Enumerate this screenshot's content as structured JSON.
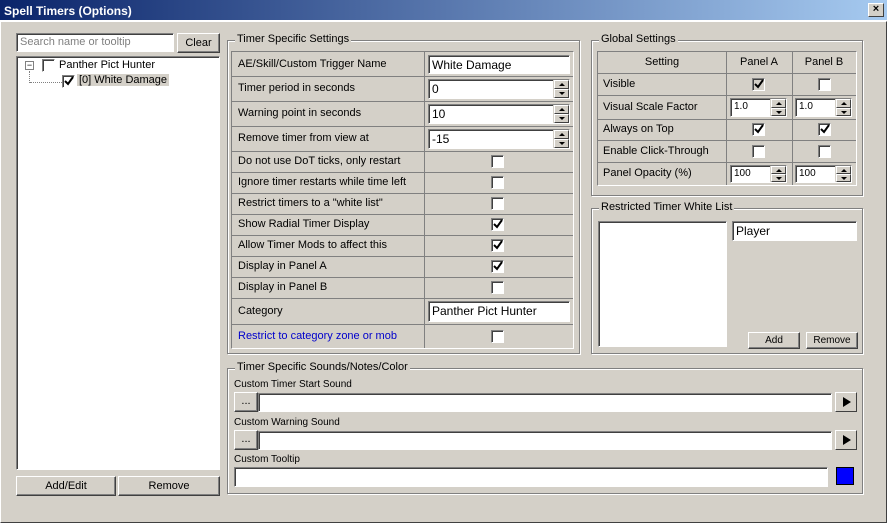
{
  "window": {
    "title": "Spell Timers (Options)",
    "close_glyph": "×"
  },
  "left": {
    "search_placeholder": "Search name or tooltip",
    "clear_label": "Clear",
    "tree": {
      "root_expander": "−",
      "root_label": "Panther Pict Hunter",
      "child_label": "[0] White Damage"
    },
    "add_edit_label": "Add/Edit",
    "remove_label": "Remove"
  },
  "timer_settings": {
    "title": "Timer Specific Settings",
    "rows": [
      {
        "label": "AE/Skill/Custom Trigger Name",
        "value": "White Damage"
      },
      {
        "label": "Timer period in seconds",
        "value": "0"
      },
      {
        "label": "Warning point in seconds",
        "value": "10"
      },
      {
        "label": "Remove timer from view at",
        "value": "-15"
      },
      {
        "label": "Do not use DoT ticks, only restart",
        "checked": false
      },
      {
        "label": "Ignore timer restarts while time left",
        "checked": false
      },
      {
        "label": "Restrict timers to a \"white list\"",
        "checked": false
      },
      {
        "label": "Show Radial Timer Display",
        "checked": true
      },
      {
        "label": "Allow Timer Mods to affect this",
        "checked": true
      },
      {
        "label": "Display in Panel A",
        "checked": true
      },
      {
        "label": "Display in Panel B",
        "checked": false
      },
      {
        "label": "Category",
        "value": "Panther Pict Hunter"
      },
      {
        "label": "Restrict to category zone or mob",
        "checked": false
      }
    ]
  },
  "global_settings": {
    "title": "Global Settings",
    "headers": [
      "Setting",
      "Panel A",
      "Panel B"
    ],
    "rows": [
      {
        "label": "Visible",
        "a_checked": true,
        "b_checked": false
      },
      {
        "label": "Visual Scale Factor",
        "a_value": "1.0",
        "b_value": "1.0"
      },
      {
        "label": "Always on Top",
        "a_checked": true,
        "b_checked": true
      },
      {
        "label": "Enable Click-Through",
        "a_checked": false,
        "b_checked": false
      },
      {
        "label": "Panel Opacity (%)",
        "a_value": "100",
        "b_value": "100"
      }
    ]
  },
  "white_list": {
    "title": "Restricted Timer White List",
    "entry_value": "Player",
    "add_label": "Add",
    "remove_label": "Remove"
  },
  "sounds": {
    "title": "Timer Specific Sounds/Notes/Color",
    "start_label": "Custom Timer Start Sound",
    "warning_label": "Custom Warning Sound",
    "tooltip_label": "Custom Tooltip",
    "browse_label": "...",
    "color": "#0000ff"
  }
}
